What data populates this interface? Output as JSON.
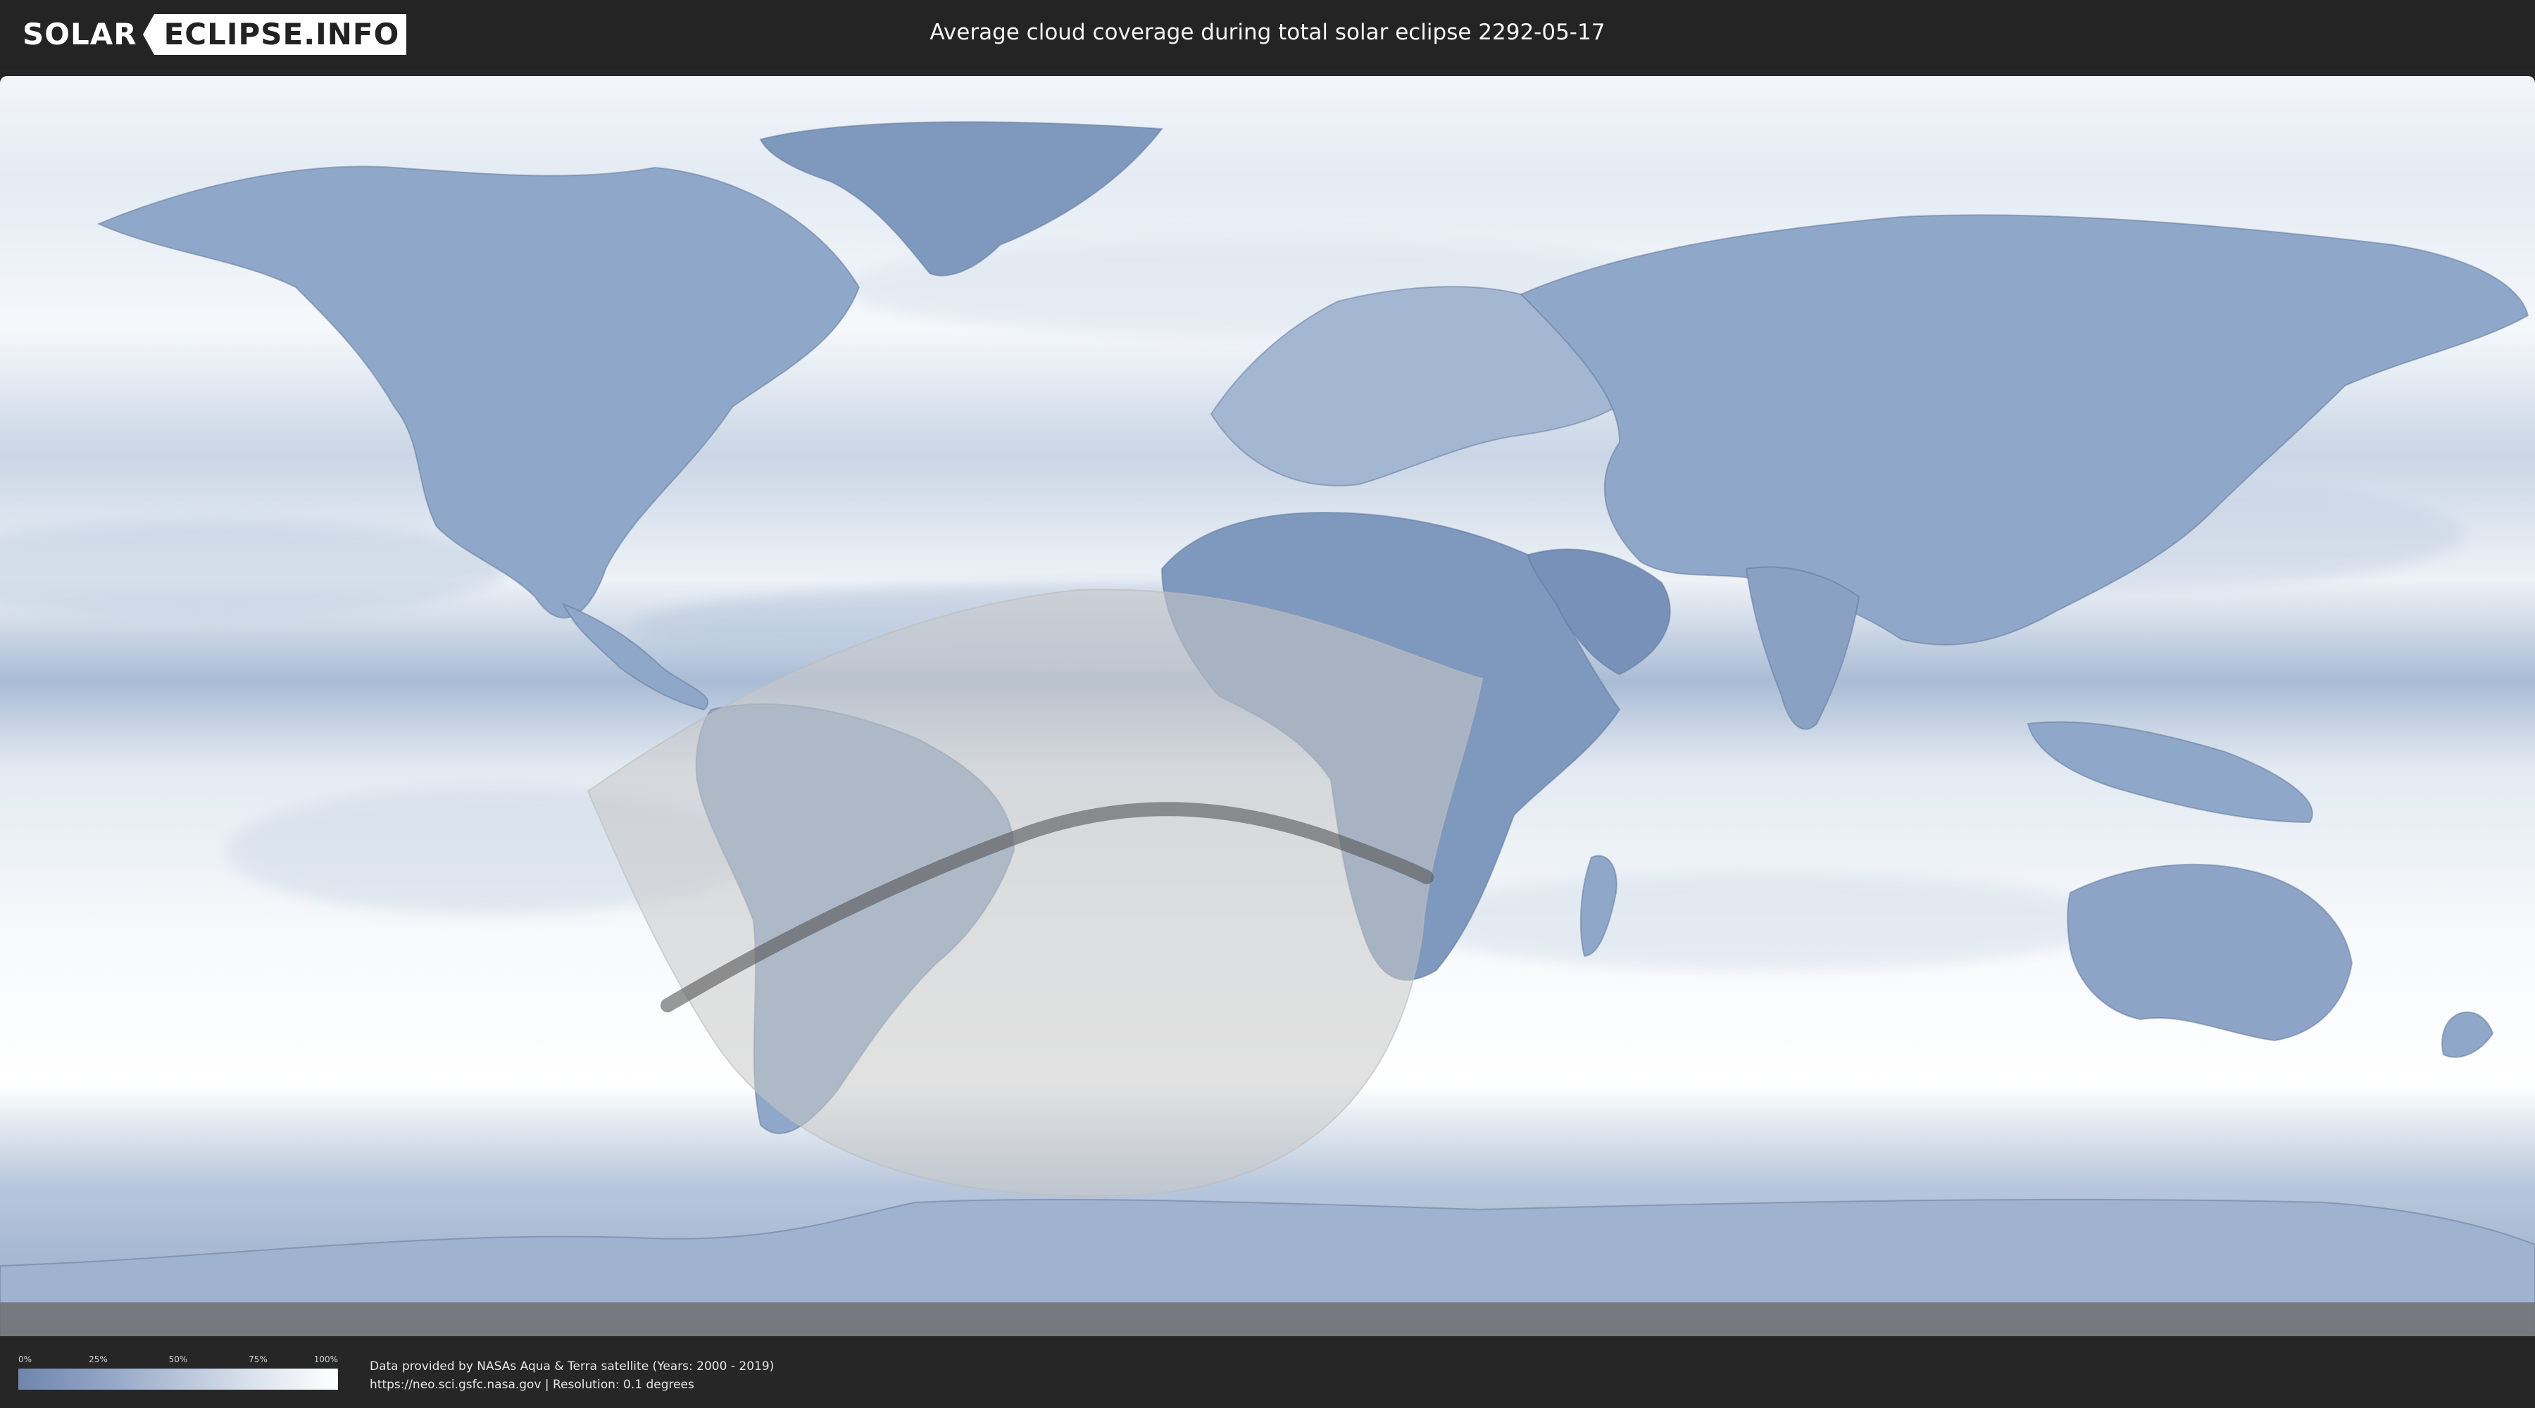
{
  "header": {
    "logo_left": "SOLAR",
    "logo_right": "ECLIPSE.INFO",
    "title": "Average cloud coverage during total solar eclipse 2292-05-17"
  },
  "legend": {
    "ticks": [
      "0%",
      "25%",
      "50%",
      "75%",
      "100%"
    ],
    "gradient_colors": [
      "#6f86ad",
      "#8ea2c3",
      "#b6c4d9",
      "#dde4ee",
      "#ffffff"
    ]
  },
  "footer": {
    "credit_line1": "Data provided by NASAs Aqua & Terra satellite (Years: 2000 - 2019)",
    "credit_line2": "https://neo.sci.gsfc.nasa.gov | Resolution: 0.1 degrees"
  },
  "colors": {
    "clear_sky": "#6f86ad",
    "overcast": "#ffffff",
    "penumbra_overlay": "#d0d0d0",
    "totality_path": "#666666"
  }
}
